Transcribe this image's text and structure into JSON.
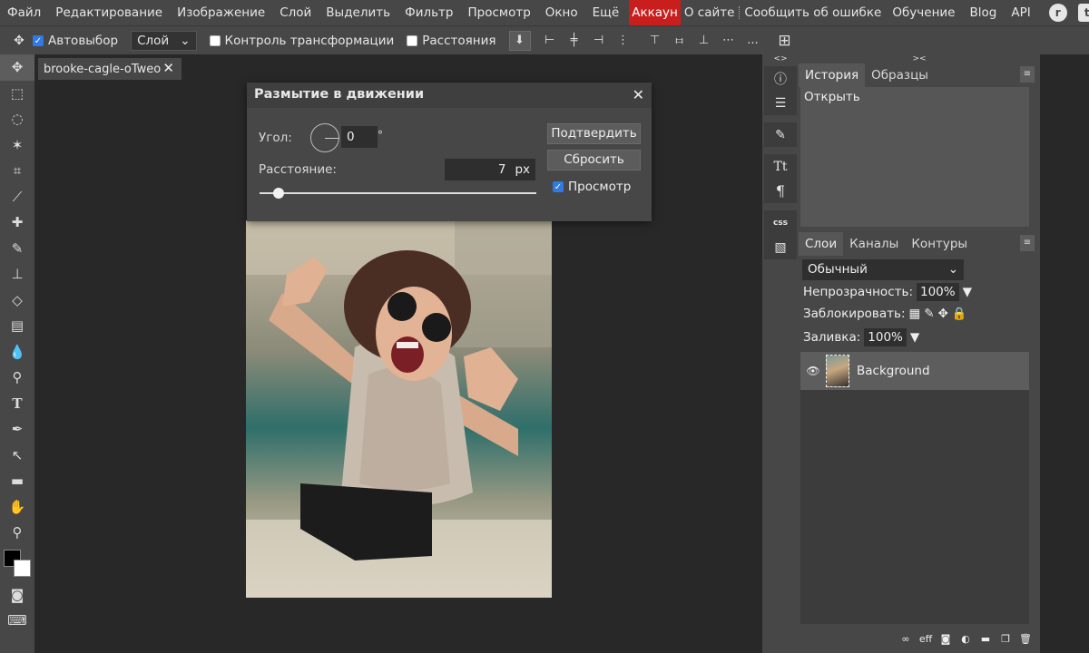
{
  "menubar": {
    "items": [
      "Файл",
      "Редактирование",
      "Изображение",
      "Слой",
      "Выделить",
      "Фильтр",
      "Просмотр",
      "Окно",
      "Ещё"
    ],
    "account": "Аккаун",
    "links": [
      "О сайте",
      "Сообщить об ошибке",
      "Обучение",
      "Blog",
      "API"
    ],
    "social_icons": [
      "reddit-icon",
      "twitter-icon",
      "facebook-icon"
    ]
  },
  "options": {
    "autoselect_label": "Автовыбор",
    "autoselect_checked": true,
    "layer_select": "Слой",
    "transform_label": "Контроль трансформации",
    "distances_label": "Расстояния",
    "more": "..."
  },
  "document": {
    "tab_title": "brooke-cagle-oTweo"
  },
  "dialog": {
    "title": "Размытие в движении",
    "angle_label": "Угол:",
    "angle_value": "0",
    "angle_unit": "°",
    "distance_label": "Расстояние:",
    "distance_value": "7",
    "distance_unit": "px",
    "slider_fraction": 0.07,
    "confirm_label": "Подтвердить",
    "reset_label": "Сбросить",
    "preview_label": "Просмотр",
    "preview_checked": true
  },
  "history_panel": {
    "tabs": [
      "История",
      "Образцы"
    ],
    "items": [
      "Открыть"
    ]
  },
  "layers_panel": {
    "tabs": [
      "Слои",
      "Каналы",
      "Контуры"
    ],
    "blend_mode": "Обычный",
    "opacity_label": "Непрозрачность:",
    "opacity_value": "100%",
    "lock_label": "Заблокировать:",
    "fill_label": "Заливка:",
    "fill_value": "100%",
    "layers": [
      {
        "name": "Background",
        "visible": true
      }
    ],
    "footer_icons": [
      "link-icon",
      "effects-icon",
      "mask-icon",
      "adjustment-icon",
      "folder-icon",
      "new-layer-icon",
      "trash-icon"
    ],
    "effects_text": "eff"
  },
  "icon_panel": {
    "css_label": "css",
    "text_icon": "Tt",
    "para_icon": "¶"
  },
  "colors": {
    "accent": "#c91e1e",
    "checkbox": "#2f7ae5",
    "panel": "#474747",
    "workspace": "#282828"
  }
}
